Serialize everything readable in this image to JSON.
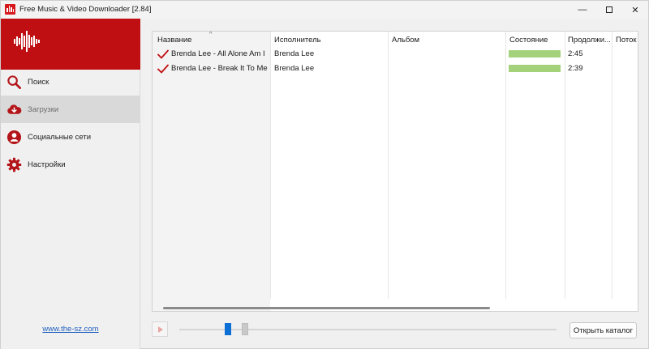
{
  "window": {
    "title": "Free Music & Video Downloader [2.84]",
    "controls": {
      "minimize": "—",
      "close": "✕"
    }
  },
  "sidebar": {
    "brand_color": "#c00f13",
    "items": [
      {
        "label": "Поиск",
        "icon": "search-icon",
        "active": false
      },
      {
        "label": "Загрузки",
        "icon": "cloud-download-icon",
        "active": true
      },
      {
        "label": "Социальные сети",
        "icon": "user-icon",
        "active": false
      },
      {
        "label": "Настройки",
        "icon": "gear-icon",
        "active": false
      }
    ],
    "footer_link": "www.the-sz.com"
  },
  "table": {
    "columns": [
      "Название",
      "Исполнитель",
      "Альбом",
      "Состояние",
      "Продолжи...",
      "Поток"
    ],
    "sort_indicator": "^",
    "rows": [
      {
        "name": "Brenda Lee - All Alone Am I",
        "artist": "Brenda Lee",
        "album": "",
        "progress": 1.0,
        "duration": "2:45",
        "stream": ""
      },
      {
        "name": "Brenda Lee - Break It To Me G...",
        "artist": "Brenda Lee",
        "album": "",
        "progress": 1.0,
        "duration": "2:39",
        "stream": ""
      }
    ],
    "progress_color": "#a4d27a",
    "check_color": "#c00f13"
  },
  "player": {
    "open_folder_label": "Открыть каталог",
    "accent_color": "#0b6fd6"
  }
}
